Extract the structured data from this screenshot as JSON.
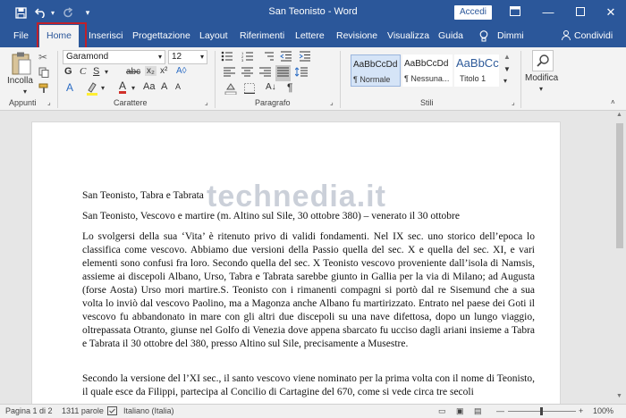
{
  "window": {
    "title": "San Teonisto  -  Word",
    "signin_label": "Accedi",
    "quick_access": [
      "save-icon",
      "undo-icon",
      "redo-icon",
      "customize-icon"
    ]
  },
  "tabs": [
    "File",
    "Home",
    "Inserisci",
    "Progettazione",
    "Layout",
    "Riferimenti",
    "Lettere",
    "Revisione",
    "Visualizza",
    "Guida",
    "Dimmi",
    "Condividi"
  ],
  "ribbon": {
    "clipboard": {
      "paste_label": "Incolla",
      "group_label": "Appunti"
    },
    "font": {
      "font_name": "Garamond",
      "font_size": "12",
      "group_label": "Carattere"
    },
    "paragraph": {
      "group_label": "Paragrafo"
    },
    "styles": {
      "group_label": "Stili",
      "items": [
        {
          "preview": "AaBbCcDd",
          "name": "¶ Normale"
        },
        {
          "preview": "AaBbCcDd",
          "name": "¶ Nessuna..."
        },
        {
          "preview": "AaBbCc",
          "name": "Titolo 1"
        }
      ]
    },
    "editing": {
      "label": "Modifica"
    }
  },
  "document": {
    "watermark": "technedia.it",
    "paragraphs": [
      "San Teonisto, Tabra e Tabrata",
      "San Teonisto, Vescovo e martire (m. Altino sul Sile, 30 ottobre 380) – venerato il 30 ottobre",
      "Lo svolgersi della sua ‘Vita’ è ritenuto privo di validi fondamenti. Nel IX sec. uno storico dell’epoca lo classifica come vescovo. Abbiamo due versioni della Passio quella del sec. X e quella del sec. XI, e vari elementi sono confusi fra loro. Secondo quella del sec. X Teonisto vescovo proveniente dall’isola di Namsis, assieme ai discepoli Albano, Urso, Tabra e Tabrata sarebbe giunto in Gallia per la via di Milano; ad Augusta (forse Aosta) Urso mori martire.S. Teonisto con i rimanenti compagni si portò dal re Sisemund che a sua volta lo inviò dal vescovo Paolino, ma a Magonza anche Albano fu martirizzato. Entrato nel paese dei Goti il vescovo fu abbandonato in mare con gli altri due discepoli su una nave difettosa, dopo un lungo viaggio, oltrepassata Otranto, giunse nel Golfo di Venezia dove appena sbarcato fu ucciso dagli ariani insieme a Tabra e Tabrata il 30 ottobre del 380, presso Altino sul Sile, precisamente a Musestre.",
      "Secondo la versione del l’XI sec., il santo vescovo viene nominato per la prima volta con il nome di Teonisto, il quale esce da Filippi, partecipa al Concilio di Cartagine del 670, come si vede circa tre secoli"
    ]
  },
  "status": {
    "page": "Pagina 1 di 2",
    "words": "1311 parole",
    "language": "Italiano (Italia)",
    "zoom": "100%"
  },
  "colors": {
    "accent": "#2b579a",
    "highlight_box": "#c0202a"
  }
}
